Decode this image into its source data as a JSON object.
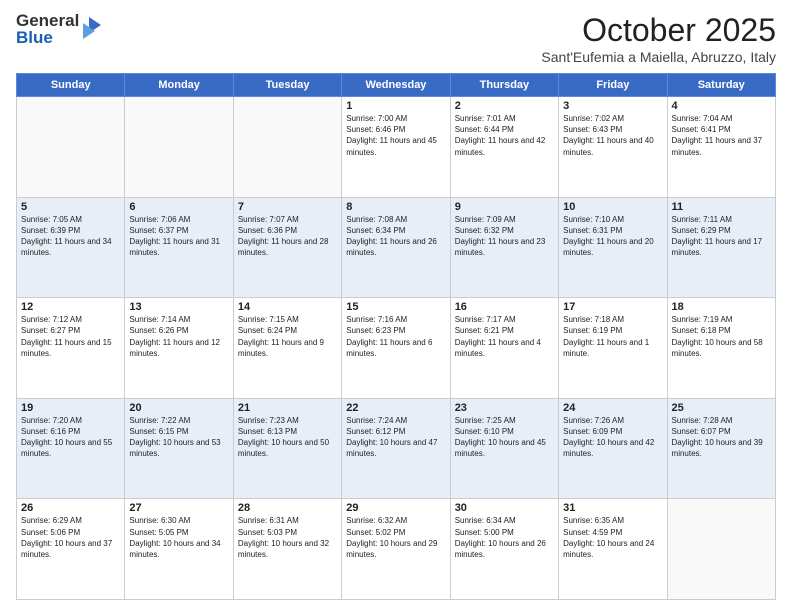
{
  "header": {
    "logo_general": "General",
    "logo_blue": "Blue",
    "month_title": "October 2025",
    "location": "Sant'Eufemia a Maiella, Abruzzo, Italy"
  },
  "weekdays": [
    "Sunday",
    "Monday",
    "Tuesday",
    "Wednesday",
    "Thursday",
    "Friday",
    "Saturday"
  ],
  "weeks": [
    [
      {
        "day": "",
        "info": ""
      },
      {
        "day": "",
        "info": ""
      },
      {
        "day": "",
        "info": ""
      },
      {
        "day": "1",
        "info": "Sunrise: 7:00 AM\nSunset: 6:46 PM\nDaylight: 11 hours and 45 minutes."
      },
      {
        "day": "2",
        "info": "Sunrise: 7:01 AM\nSunset: 6:44 PM\nDaylight: 11 hours and 42 minutes."
      },
      {
        "day": "3",
        "info": "Sunrise: 7:02 AM\nSunset: 6:43 PM\nDaylight: 11 hours and 40 minutes."
      },
      {
        "day": "4",
        "info": "Sunrise: 7:04 AM\nSunset: 6:41 PM\nDaylight: 11 hours and 37 minutes."
      }
    ],
    [
      {
        "day": "5",
        "info": "Sunrise: 7:05 AM\nSunset: 6:39 PM\nDaylight: 11 hours and 34 minutes."
      },
      {
        "day": "6",
        "info": "Sunrise: 7:06 AM\nSunset: 6:37 PM\nDaylight: 11 hours and 31 minutes."
      },
      {
        "day": "7",
        "info": "Sunrise: 7:07 AM\nSunset: 6:36 PM\nDaylight: 11 hours and 28 minutes."
      },
      {
        "day": "8",
        "info": "Sunrise: 7:08 AM\nSunset: 6:34 PM\nDaylight: 11 hours and 26 minutes."
      },
      {
        "day": "9",
        "info": "Sunrise: 7:09 AM\nSunset: 6:32 PM\nDaylight: 11 hours and 23 minutes."
      },
      {
        "day": "10",
        "info": "Sunrise: 7:10 AM\nSunset: 6:31 PM\nDaylight: 11 hours and 20 minutes."
      },
      {
        "day": "11",
        "info": "Sunrise: 7:11 AM\nSunset: 6:29 PM\nDaylight: 11 hours and 17 minutes."
      }
    ],
    [
      {
        "day": "12",
        "info": "Sunrise: 7:12 AM\nSunset: 6:27 PM\nDaylight: 11 hours and 15 minutes."
      },
      {
        "day": "13",
        "info": "Sunrise: 7:14 AM\nSunset: 6:26 PM\nDaylight: 11 hours and 12 minutes."
      },
      {
        "day": "14",
        "info": "Sunrise: 7:15 AM\nSunset: 6:24 PM\nDaylight: 11 hours and 9 minutes."
      },
      {
        "day": "15",
        "info": "Sunrise: 7:16 AM\nSunset: 6:23 PM\nDaylight: 11 hours and 6 minutes."
      },
      {
        "day": "16",
        "info": "Sunrise: 7:17 AM\nSunset: 6:21 PM\nDaylight: 11 hours and 4 minutes."
      },
      {
        "day": "17",
        "info": "Sunrise: 7:18 AM\nSunset: 6:19 PM\nDaylight: 11 hours and 1 minute."
      },
      {
        "day": "18",
        "info": "Sunrise: 7:19 AM\nSunset: 6:18 PM\nDaylight: 10 hours and 58 minutes."
      }
    ],
    [
      {
        "day": "19",
        "info": "Sunrise: 7:20 AM\nSunset: 6:16 PM\nDaylight: 10 hours and 55 minutes."
      },
      {
        "day": "20",
        "info": "Sunrise: 7:22 AM\nSunset: 6:15 PM\nDaylight: 10 hours and 53 minutes."
      },
      {
        "day": "21",
        "info": "Sunrise: 7:23 AM\nSunset: 6:13 PM\nDaylight: 10 hours and 50 minutes."
      },
      {
        "day": "22",
        "info": "Sunrise: 7:24 AM\nSunset: 6:12 PM\nDaylight: 10 hours and 47 minutes."
      },
      {
        "day": "23",
        "info": "Sunrise: 7:25 AM\nSunset: 6:10 PM\nDaylight: 10 hours and 45 minutes."
      },
      {
        "day": "24",
        "info": "Sunrise: 7:26 AM\nSunset: 6:09 PM\nDaylight: 10 hours and 42 minutes."
      },
      {
        "day": "25",
        "info": "Sunrise: 7:28 AM\nSunset: 6:07 PM\nDaylight: 10 hours and 39 minutes."
      }
    ],
    [
      {
        "day": "26",
        "info": "Sunrise: 6:29 AM\nSunset: 5:06 PM\nDaylight: 10 hours and 37 minutes."
      },
      {
        "day": "27",
        "info": "Sunrise: 6:30 AM\nSunset: 5:05 PM\nDaylight: 10 hours and 34 minutes."
      },
      {
        "day": "28",
        "info": "Sunrise: 6:31 AM\nSunset: 5:03 PM\nDaylight: 10 hours and 32 minutes."
      },
      {
        "day": "29",
        "info": "Sunrise: 6:32 AM\nSunset: 5:02 PM\nDaylight: 10 hours and 29 minutes."
      },
      {
        "day": "30",
        "info": "Sunrise: 6:34 AM\nSunset: 5:00 PM\nDaylight: 10 hours and 26 minutes."
      },
      {
        "day": "31",
        "info": "Sunrise: 6:35 AM\nSunset: 4:59 PM\nDaylight: 10 hours and 24 minutes."
      },
      {
        "day": "",
        "info": ""
      }
    ]
  ]
}
